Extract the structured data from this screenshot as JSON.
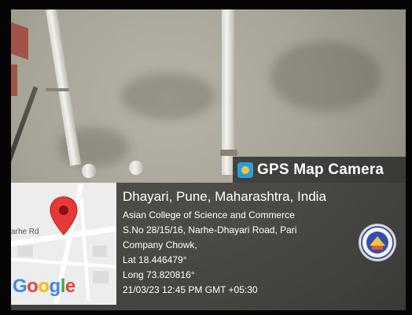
{
  "header": {
    "title": "GPS Map Camera",
    "logo_icon": "gps-map-camera-icon",
    "logo_color": "#2d9fd8"
  },
  "map": {
    "road_label": "arhe Rd",
    "brand": "Google",
    "pin_color": "#e53935"
  },
  "location": {
    "city_line": "Dhayari, Pune, Maharashtra, India",
    "address_lines": [
      "Asian College of Science and Commerce",
      "S.No 28/15/16, Narhe-Dhayari Road, Pari",
      "Company Chowk,"
    ],
    "latitude": "Lat 18.446479°",
    "longitude": "Long 73.820816°",
    "timestamp": "21/03/23 12:45 PM GMT +05:30"
  },
  "badge": {
    "icon": "college-emblem-icon"
  }
}
